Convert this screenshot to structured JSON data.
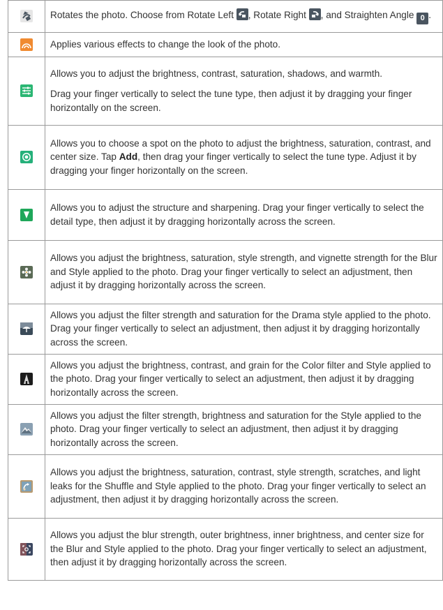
{
  "rows": [
    {
      "icon": "rotate-icon",
      "text_parts": {
        "a": "Rotates the photo. Choose from Rotate Left ",
        "b": ", Rotate Right ",
        "c": ", and Straighten Angle ",
        "d": "."
      },
      "inline_icons": [
        "rotate-left-icon",
        "rotate-right-icon",
        "straighten-angle-icon"
      ],
      "straighten_value": "0"
    },
    {
      "icon": "effects-icon",
      "text": "Applies various effects to change the look of the photo."
    },
    {
      "icon": "tune-icon",
      "text": "Allows you to adjust the brightness, contrast, saturation, shadows, and warmth.",
      "text2": "Drag your finger vertically to select the tune type, then adjust it by dragging your finger horizontally on the screen."
    },
    {
      "icon": "selective-icon",
      "text_a": "Allows you to choose a spot on the photo to adjust the brightness, saturation, contrast, and center size. Tap ",
      "bold": "Add",
      "text_b": ", then drag your finger vertically to select the tune type. Adjust it by dragging your finger horizontally on the screen."
    },
    {
      "icon": "details-icon",
      "text": "Allows you to adjust the structure and sharpening. Drag your finger vertically to select the detail type, then adjust it by dragging horizontally across the screen."
    },
    {
      "icon": "blur-style-icon",
      "text": "Allows you adjust the brightness, saturation, style strength, and vignette strength for the Blur and Style applied to the photo. Drag your finger vertically to select an adjustment, then adjust it by dragging horizontally across the screen."
    },
    {
      "icon": "drama-icon",
      "text": "Allows you adjust the filter strength and saturation for the Drama style applied to the photo. Drag your finger vertically to select an adjustment, then adjust it by dragging horizontally across the screen."
    },
    {
      "icon": "color-filter-icon",
      "text": "Allows you adjust the brightness, contrast, and grain for the Color filter and Style applied to the photo. Drag your finger vertically to select an adjustment, then adjust it by dragging horizontally across the screen."
    },
    {
      "icon": "landscape-style-icon",
      "text": "Allows you adjust the filter strength, brightness and saturation for the Style applied to the photo. Drag your finger vertically to select an adjustment, then adjust it by dragging horizontally across the screen."
    },
    {
      "icon": "shuffle-style-icon",
      "text": "Allows you adjust the brightness, saturation, contrast, style strength, scratches, and light leaks for the Shuffle and Style applied to the photo. Drag your finger vertically to select an adjustment, then adjust it by dragging horizontally across the screen."
    },
    {
      "icon": "tilt-shift-icon",
      "text": "Allows you adjust the blur strength, outer brightness, inner brightness, and center size for the Blur and Style applied to the photo. Drag your finger vertically to select an adjustment, then adjust it by dragging horizontally across the screen."
    }
  ],
  "colors": {
    "border": "#9a9a9a",
    "text": "#333333",
    "rotate_bg": "#d9d9d9",
    "effects_bg": "#f08a30",
    "tune_bg": "#2bb673",
    "selective_bg": "#25b07a",
    "details_bg": "#1fa75a",
    "icon_dark": "#4a5560"
  }
}
